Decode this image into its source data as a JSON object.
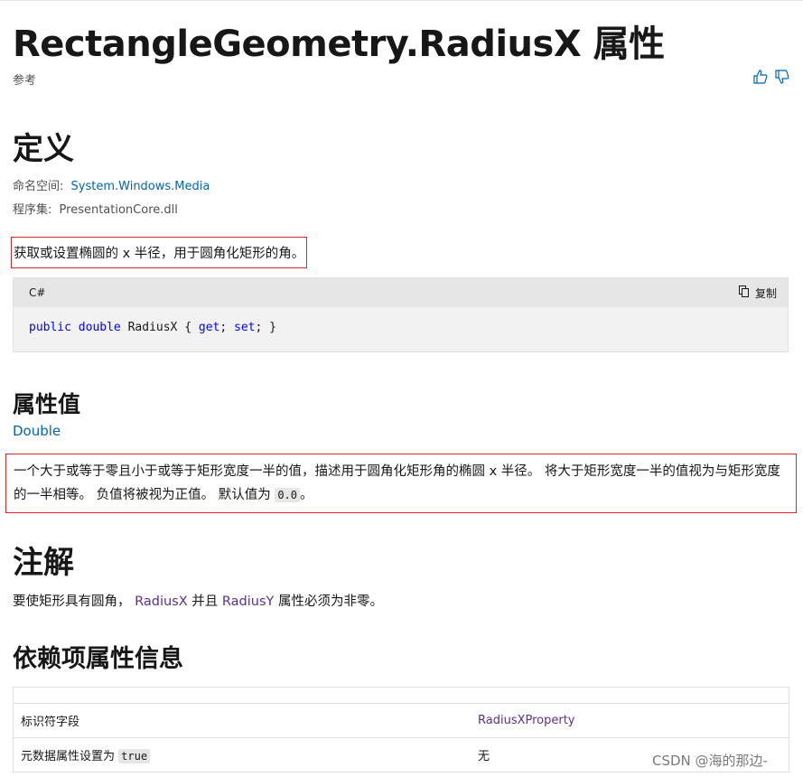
{
  "page": {
    "title": "RectangleGeometry.RadiusX 属性",
    "reference_label": "参考"
  },
  "definition": {
    "heading": "定义",
    "namespace_label": "命名空间:",
    "namespace_value": "System.Windows.Media",
    "assembly_label": "程序集:",
    "assembly_value": "PresentationCore.dll",
    "summary": "获取或设置椭圆的 x 半径，用于圆角化矩形的角。"
  },
  "code": {
    "language": "C#",
    "copy_label": "复制",
    "tokens": {
      "public": "public",
      "double": "double",
      "name": "RadiusX",
      "open": " { ",
      "get": "get",
      "semi1": "; ",
      "set": "set",
      "close": "; }"
    }
  },
  "property_value": {
    "heading": "属性值",
    "type_link": "Double",
    "desc_part1": "一个大于或等于零且小于或等于矩形宽度一半的值，描述用于圆角化矩形角的椭圆 x 半径。 将大于矩形宽度一半的值视为与矩形宽度的一半相等。 负值将被视为正值。 默认值为 ",
    "default_value": "0.0",
    "desc_part2": "。"
  },
  "remarks": {
    "heading": "注解",
    "text_before": "要使矩形具有圆角， ",
    "link1": "RadiusX",
    "text_middle": " 并且 ",
    "link2": "RadiusY",
    "text_after": " 属性必须为非零。"
  },
  "dependency": {
    "heading": "依赖项属性信息",
    "rows": [
      {
        "label": "标识符字段",
        "value": "RadiusXProperty"
      },
      {
        "label": "元数据属性设置为",
        "code": "true",
        "value": "无"
      }
    ]
  },
  "watermark": "CSDN @海的那边-",
  "colors": {
    "link": "#0065b3",
    "visited_link": "#5c2e91",
    "highlight_border": "#e0242c",
    "code_keyword": "#0000ff"
  }
}
